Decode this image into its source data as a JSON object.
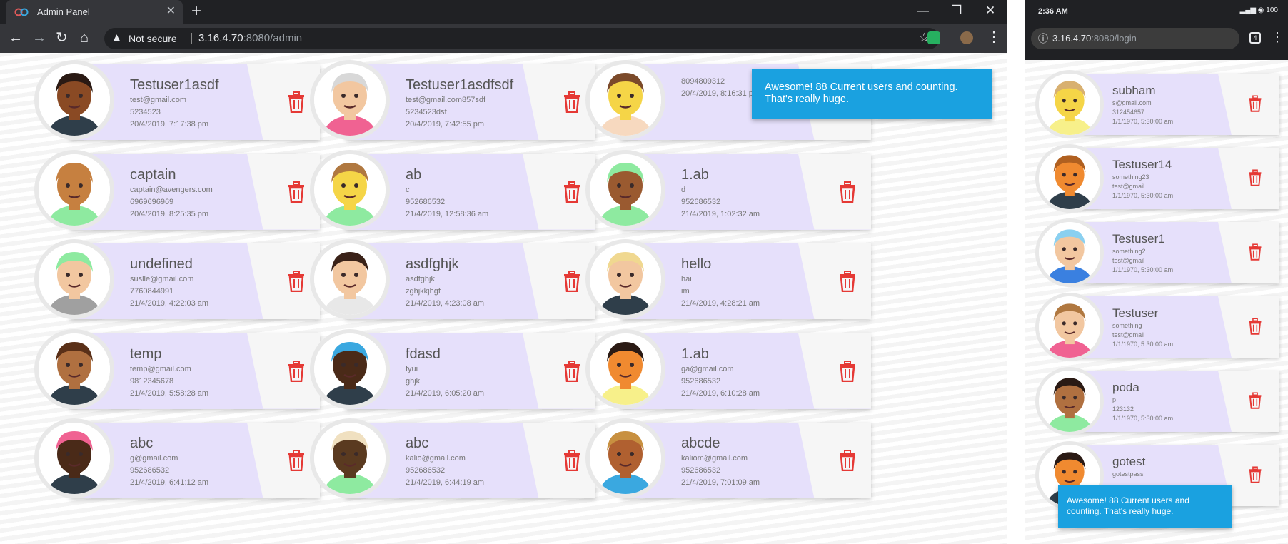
{
  "desktop": {
    "tab_title": "Admin Panel",
    "not_secure": "Not secure",
    "url_host": "3.16.4.70",
    "url_rest": ":8080/admin",
    "toast": "Awesome! 88 Current users and counting. That's really huge.",
    "users": [
      {
        "name": "Testuser1asdf",
        "email": "test@gmail.com",
        "phone": "5234523",
        "date": "20/4/2019, 7:17:38 pm",
        "skin": "#8a4a24",
        "hair": "#2a1a14",
        "shirt": "#2f3e4a"
      },
      {
        "name": "Testuser1asdfsdf",
        "email": "test@gmail.com857sdf",
        "phone": "5234523dsf",
        "date": "20/4/2019, 7:42:55 pm",
        "skin": "#f2c7a0",
        "hair": "#d8d8d8",
        "shirt": "#f06292"
      },
      {
        "name": "",
        "email": "",
        "phone": "8094809312",
        "date": "20/4/2019, 8:16:31 pm",
        "skin": "#f5d547",
        "hair": "#7b4a2a",
        "shirt": "#f7d9bf"
      },
      {
        "name": "captain",
        "email": "captain@avengers.com",
        "phone": "6969696969",
        "date": "20/4/2019, 8:25:35 pm",
        "skin": "#c68040",
        "hair": "#c68040",
        "shirt": "#8eeaa0"
      },
      {
        "name": "ab",
        "email": "c",
        "phone": "952686532",
        "date": "21/4/2019, 12:58:36 am",
        "skin": "#f5d547",
        "hair": "#b07840",
        "shirt": "#8eeaa0"
      },
      {
        "name": "1.ab",
        "email": "d",
        "phone": "952686532",
        "date": "21/4/2019, 1:02:32 am",
        "skin": "#9a5a30",
        "hair": "#8eeaa0",
        "shirt": "#8eeaa0"
      },
      {
        "name": "undefined",
        "email": "suslle@gmail.com",
        "phone": "7760844991",
        "date": "21/4/2019, 4:22:03 am",
        "skin": "#f2c7a0",
        "hair": "#8eeaa0",
        "shirt": "#a0a0a0"
      },
      {
        "name": "asdfghjk",
        "email": "asdfghjk",
        "phone": "zghjkkjhgf",
        "date": "21/4/2019, 4:23:08 am",
        "skin": "#f2c7a0",
        "hair": "#3a2218",
        "shirt": "#e8e8e8"
      },
      {
        "name": "hello",
        "email": "hai",
        "phone": "im",
        "date": "21/4/2019, 4:28:21 am",
        "skin": "#f2c7a0",
        "hair": "#f0d890",
        "shirt": "#2f3e4a"
      },
      {
        "name": "temp",
        "email": "temp@gmail.com",
        "phone": "9812345678",
        "date": "21/4/2019, 5:58:28 am",
        "skin": "#b07040",
        "hair": "#5a3018",
        "shirt": "#2f3e4a"
      },
      {
        "name": "fdasd",
        "email": "fyui",
        "phone": "ghjk",
        "date": "21/4/2019, 6:05:20 am",
        "skin": "#4a2a18",
        "hair": "#3aa8e0",
        "shirt": "#2f3e4a"
      },
      {
        "name": "1.ab",
        "email": "ga@gmail.com",
        "phone": "952686532",
        "date": "21/4/2019, 6:10:28 am",
        "skin": "#f08a30",
        "hair": "#2a1a14",
        "shirt": "#f7f08a"
      },
      {
        "name": "abc",
        "email": "g@gmail.com",
        "phone": "952686532",
        "date": "21/4/2019, 6:41:12 am",
        "skin": "#4a2a18",
        "hair": "#f06292",
        "shirt": "#2f3e4a"
      },
      {
        "name": "abc",
        "email": "kalio@gmail.com",
        "phone": "952686532",
        "date": "21/4/2019, 6:44:19 am",
        "skin": "#5a3a20",
        "hair": "#f0e0c0",
        "shirt": "#8eeaa0"
      },
      {
        "name": "abcde",
        "email": "kaliom@gmail.com",
        "phone": "952686532",
        "date": "21/4/2019, 7:01:09 am",
        "skin": "#b06030",
        "hair": "#c89040",
        "shirt": "#3aa8e0"
      }
    ]
  },
  "mobile": {
    "time": "2:36 AM",
    "status_icons": "▂▄▆ ◉ 100",
    "tab_count": "4",
    "url_host": "3.16.4.70",
    "url_rest": ":8080/login",
    "toast": "Awesome! 88 Current users and counting. That's really huge.",
    "users": [
      {
        "name": "subham",
        "l1": "s@gmail.com",
        "l2": "312454657",
        "l3": "1/1/1970, 5:30:00 am",
        "skin": "#f5d547",
        "hair": "#d8b070",
        "shirt": "#f7f08a"
      },
      {
        "name": "Testuser14",
        "l1": "something23",
        "l2": "test@gmail",
        "l3": "1/1/1970, 5:30:00 am",
        "skin": "#f08a30",
        "hair": "#b06020",
        "shirt": "#2f3e4a"
      },
      {
        "name": "Testuser1",
        "l1": "something2",
        "l2": "test@gmail",
        "l3": "1/1/1970, 5:30:00 am",
        "skin": "#f2c7a0",
        "hair": "#8ad0f0",
        "shirt": "#3a80e0"
      },
      {
        "name": "Testuser",
        "l1": "something",
        "l2": "test@gmail",
        "l3": "1/1/1970, 5:30:00 am",
        "skin": "#f2c7a0",
        "hair": "#b07840",
        "shirt": "#f06292"
      },
      {
        "name": "poda",
        "l1": "p",
        "l2": "123132",
        "l3": "1/1/1970, 5:30:00 am",
        "skin": "#b07040",
        "hair": "#2a1a14",
        "shirt": "#8eeaa0"
      },
      {
        "name": "gotest",
        "l1": "gotestpass",
        "l2": "",
        "l3": "",
        "skin": "#f08a30",
        "hair": "#2a1a14",
        "shirt": "#2f3e4a"
      }
    ]
  }
}
